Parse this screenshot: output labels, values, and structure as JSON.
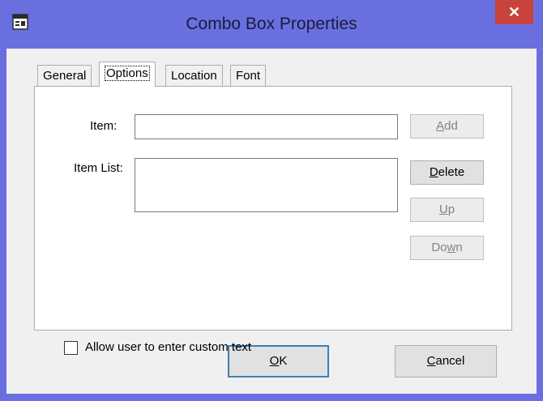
{
  "window": {
    "title": "Combo Box Properties",
    "close_glyph": "✕"
  },
  "tabs": [
    {
      "label": "General",
      "active": false
    },
    {
      "label": "Options",
      "active": true
    },
    {
      "label": "Location",
      "active": false
    },
    {
      "label": "Font",
      "active": false
    }
  ],
  "options": {
    "item_label": "Item:",
    "item_value": "",
    "item_list_label": "Item List:",
    "item_list_value": "",
    "add_prefix": "",
    "add_ul": "A",
    "add_suffix": "dd",
    "delete_prefix": "",
    "delete_ul": "D",
    "delete_suffix": "elete",
    "up_prefix": "",
    "up_ul": "U",
    "up_suffix": "p",
    "down_prefix": "Do",
    "down_ul": "w",
    "down_suffix": "n",
    "custom_text_label": "Allow user to enter custom text",
    "custom_text_checked": false
  },
  "footer": {
    "ok_prefix": "",
    "ok_ul": "O",
    "ok_suffix": "K",
    "cancel_prefix": "",
    "cancel_ul": "C",
    "cancel_suffix": "ancel"
  },
  "colors": {
    "frame": "#6a6fe0",
    "close": "#c7433b",
    "dialog_bg": "#f0f0f0"
  }
}
